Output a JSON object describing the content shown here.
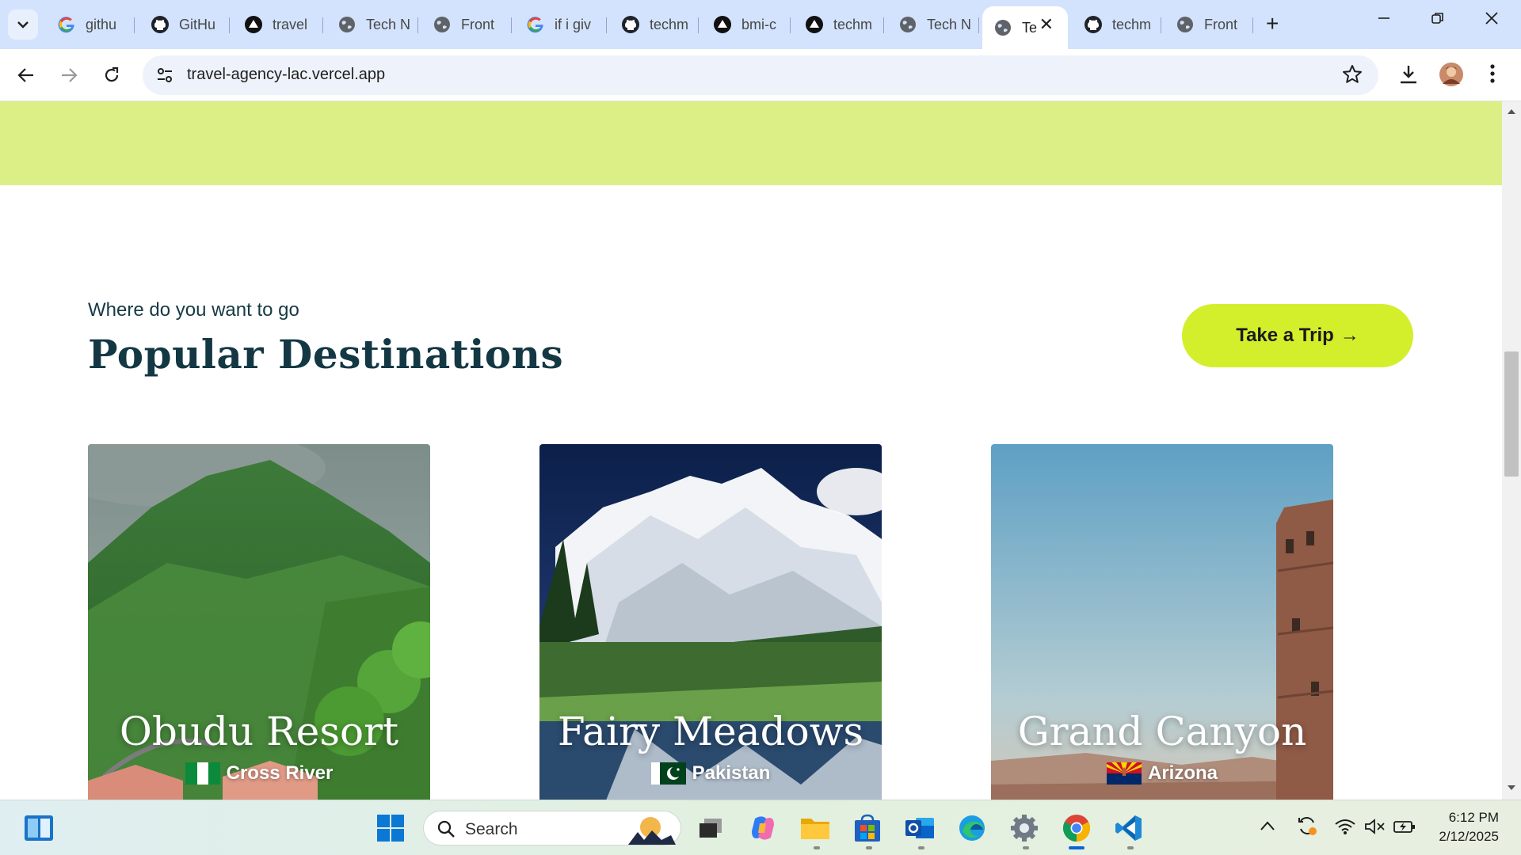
{
  "browser": {
    "tabs": [
      {
        "label": "githu",
        "favicon": "google-icon"
      },
      {
        "label": "GitHu",
        "favicon": "github-icon"
      },
      {
        "label": "travel",
        "favicon": "vercel-icon"
      },
      {
        "label": "Tech N",
        "favicon": "globe-icon"
      },
      {
        "label": "Front",
        "favicon": "globe-icon"
      },
      {
        "label": "if i giv",
        "favicon": "google-icon"
      },
      {
        "label": "techm",
        "favicon": "github-icon"
      },
      {
        "label": "bmi-c",
        "favicon": "vercel-icon"
      },
      {
        "label": "techm",
        "favicon": "vercel-icon"
      },
      {
        "label": "Tech N",
        "favicon": "globe-icon"
      },
      {
        "label": "Te",
        "favicon": "globe-icon",
        "active": true
      },
      {
        "label": "techm",
        "favicon": "github-icon"
      },
      {
        "label": "Front",
        "favicon": "globe-icon"
      }
    ],
    "url": "travel-agency-lac.vercel.app"
  },
  "section": {
    "subtitle": "Where do you want to go",
    "title": "Popular Destinations",
    "cta_label": "Take a Trip",
    "cta_arrow": "→"
  },
  "cards": [
    {
      "title": "Obudu Resort",
      "place": "Cross River",
      "flag": "nigeria-flag"
    },
    {
      "title": "Fairy Meadows",
      "place": "Pakistan",
      "flag": "pakistan-flag"
    },
    {
      "title": "Grand Canyon",
      "place": "Arizona",
      "flag": "arizona-flag"
    }
  ],
  "taskbar": {
    "search_label": "Search",
    "time": "6:12 PM",
    "date": "2/12/2025"
  },
  "colors": {
    "accent_lime": "#d3ef2c",
    "band_lime": "#dcee86",
    "heading": "#133844"
  }
}
